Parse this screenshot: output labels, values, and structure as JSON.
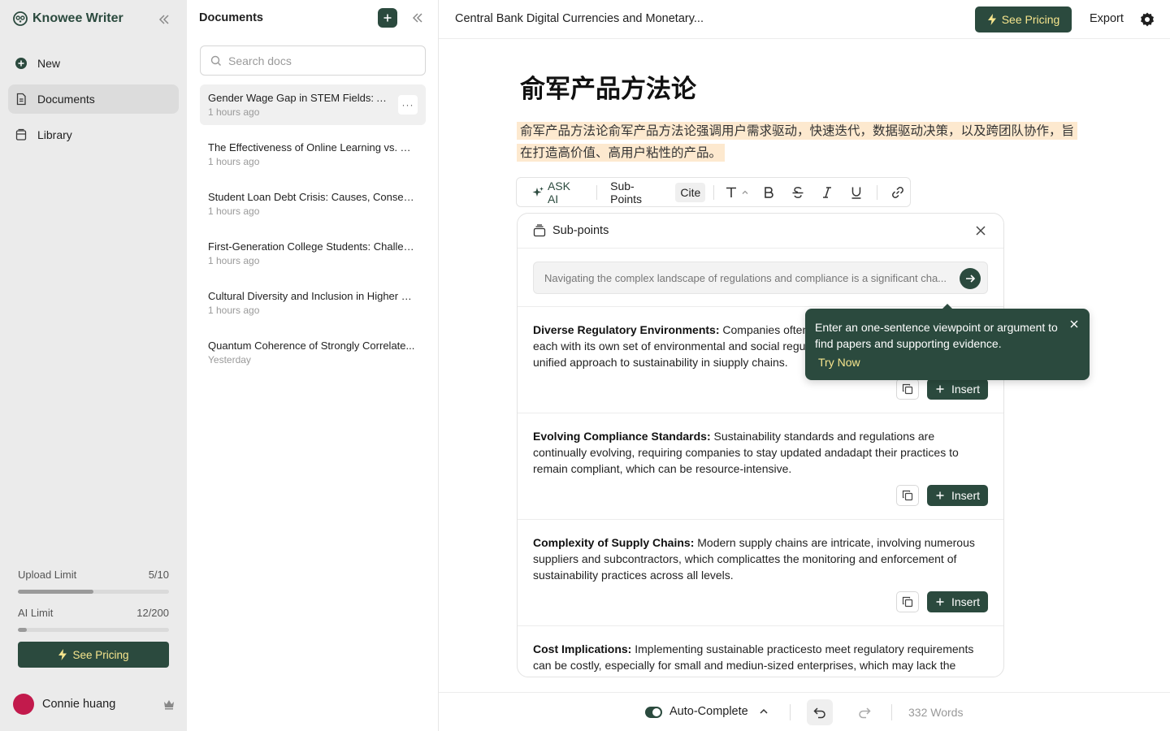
{
  "brand": {
    "name": "Knowee Writer"
  },
  "nav": {
    "items": [
      {
        "label": "New",
        "icon": "plus-circle-icon"
      },
      {
        "label": "Documents",
        "icon": "document-icon",
        "active": true
      },
      {
        "label": "Library",
        "icon": "library-icon"
      }
    ]
  },
  "limits": {
    "upload": {
      "label": "Upload Limit",
      "value": "5/10",
      "fraction": 0.5
    },
    "ai": {
      "label": "AI Limit",
      "value": "12/200",
      "fraction": 0.06
    }
  },
  "sidebar_pricing_label": "See Pricing",
  "user": {
    "name": "Connie huang",
    "avatar_color": "#c21a4c"
  },
  "docs_panel": {
    "title": "Documents",
    "search_placeholder": "Search docs",
    "documents": [
      {
        "title": "Gender Wage Gap in STEM Fields: A...",
        "time": "1 hours ago",
        "active": true
      },
      {
        "title": "The Effectiveness of Online Learning vs. Tr...",
        "time": "1 hours ago"
      },
      {
        "title": "Student Loan Debt Crisis: Causes, Conseq...",
        "time": "1 hours ago"
      },
      {
        "title": "First-Generation College Students: Challen...",
        "time": "1 hours ago"
      },
      {
        "title": "Cultural Diversity and Inclusion in Higher E...",
        "time": "1 hours ago"
      },
      {
        "title": "Quantum Coherence of Strongly Correlate...",
        "time": "Yesterday"
      }
    ],
    "more_label": "···"
  },
  "editor": {
    "heading": "Central Bank Digital Currencies and Monetary...",
    "pricing_label": "See Pricing",
    "export_label": "Export",
    "title": "俞军产品方法论",
    "paragraph": "俞军产品方法论俞军产品方法论强调用户需求驱动，快速迭代，数据驱动决策，以及跨团队协作，旨在打造高价值、高用户粘性的产品。",
    "toolbar": {
      "ask_ai": "ASK AI",
      "sub_points": "Sub-Points",
      "cite": "Cite"
    }
  },
  "subpoints": {
    "title": "Sub-points",
    "input_value": "Navigating the complex landscape of regulations and compliance is a significant cha...",
    "insert_label": "Insert",
    "items": [
      {
        "heading": "Diverse Regulatory Environments:",
        "body": " Companies often operate in multiple jurisdictions, each with its own set of environmental and social regulations, making it difficult to create a unified approach to sustainability in siupply chains."
      },
      {
        "heading": "Evolving Compliance Standards:",
        "body": " Sustainability standards and regulations are continually evolving, requiring companies to stay updated andadapt their practices to remain compliant, which can be resource-intensive."
      },
      {
        "heading": "Complexity of Supply Chains:",
        "body": " Modern supply chains are intricate, involving numerous suppliers and subcontractors, which complicattes the monitoring and enforcement of sustainability practices across all levels."
      },
      {
        "heading": "Cost Implications:",
        "body": " Implementing sustainable practicesto meet regulatory requirements can be costly, especially for small and mediun-sized enterprises, which may lack the financial resources to invest in compliance."
      }
    ]
  },
  "tooltip": {
    "text": "Enter an one-sentence viewpoint or argument to find papers and supporting evidence.",
    "action": "Try Now"
  },
  "bottombar": {
    "autocomplete_label": "Auto-Complete",
    "autocomplete_on": true,
    "word_count": "332 Words"
  },
  "colors": {
    "brand": "#2b4a3e",
    "accent_text": "#f6e58d",
    "highlight": "#fde9cf"
  }
}
